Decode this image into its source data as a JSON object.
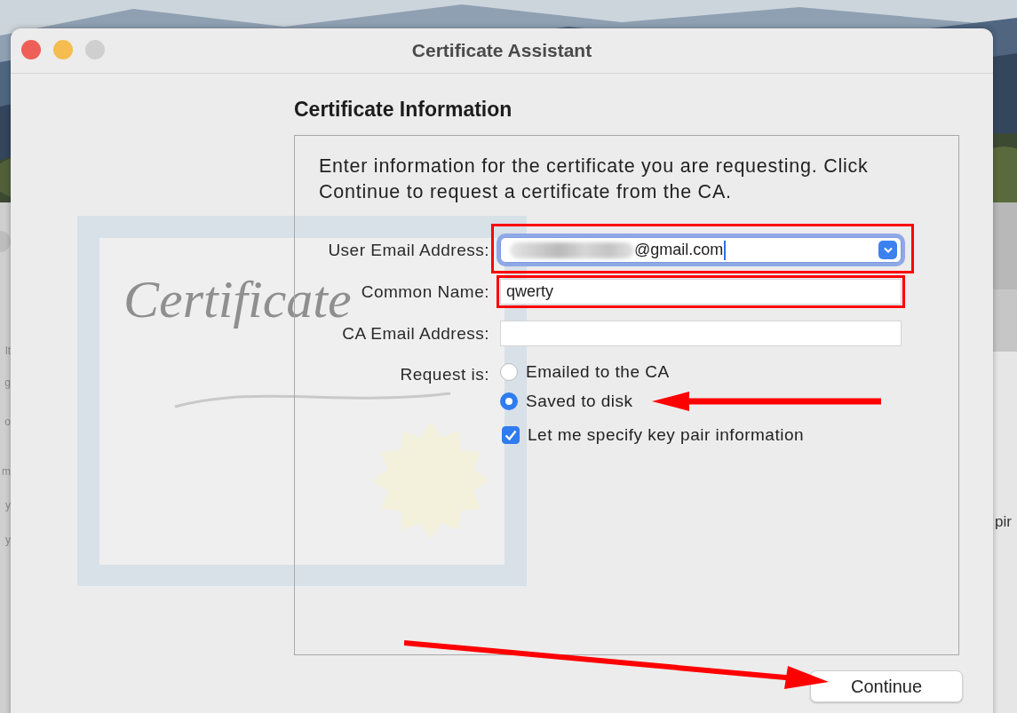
{
  "window": {
    "title": "Certificate Assistant",
    "controls": [
      {
        "kind": "close"
      },
      {
        "kind": "minimize"
      },
      {
        "kind": "zoom"
      }
    ]
  },
  "background_windows": {
    "left_fragments": [
      "lt",
      "g",
      "o",
      "m",
      "y",
      "y"
    ],
    "right_fragments": [
      "pir"
    ]
  },
  "certificate_art": {
    "text": "Certificate"
  },
  "heading": "Certificate Information",
  "intro": "Enter information for the certificate you are requesting. Click Continue to request a certificate from the CA.",
  "fields": [
    {
      "label": "User Email Address:",
      "kind": "combo",
      "value": "@gmail.com",
      "redacted": true,
      "focused": true,
      "highlighted": true
    },
    {
      "label": "Common Name:",
      "kind": "text",
      "value": "qwerty",
      "focused": false,
      "highlighted": true
    },
    {
      "label": "CA Email Address:",
      "kind": "text",
      "focused": false,
      "highlighted": false
    }
  ],
  "request": {
    "label": "Request is:",
    "options": [
      {
        "label": "Emailed to the CA",
        "selected": false,
        "arrow": false
      },
      {
        "label": "Saved to disk",
        "selected": true,
        "arrow": true
      }
    ]
  },
  "key_pair_checkbox": {
    "label": "Let me specify key pair information",
    "checked": true
  },
  "continue_button": {
    "label": "Continue",
    "arrow": true
  }
}
